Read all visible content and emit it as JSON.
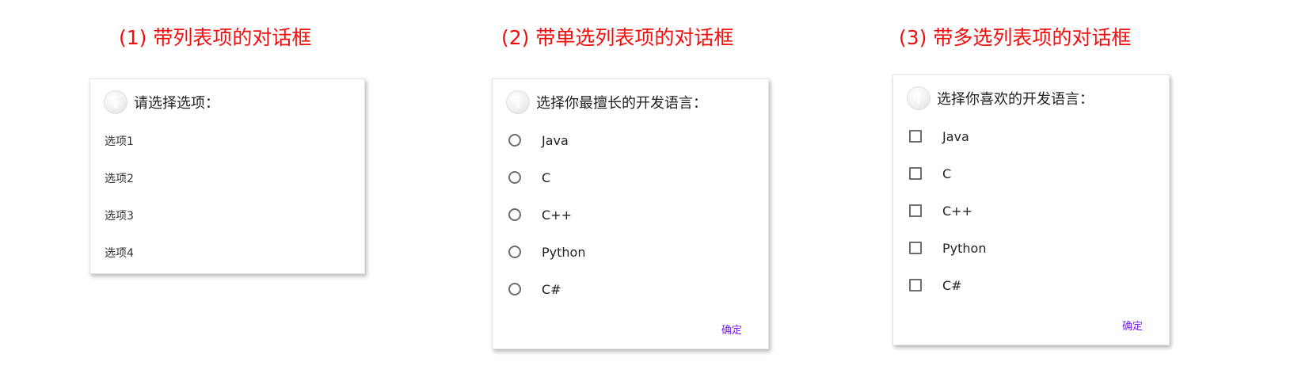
{
  "captions": {
    "c1": "(1) 带列表项的对话框",
    "c2": "(2) 带单选列表项的对话框",
    "c3": "(3) 带多选列表项的对话框"
  },
  "dialog1": {
    "icon": "info-icon",
    "title": "请选择选项：",
    "items": [
      "选项1",
      "选项2",
      "选项3",
      "选项4"
    ]
  },
  "dialog2": {
    "icon": "info-icon",
    "title": "选择你最擅长的开发语言：",
    "options": [
      "Java",
      "C",
      "C++",
      "Python",
      "C#"
    ],
    "ok": "确定"
  },
  "dialog3": {
    "icon": "info-icon",
    "title": "选择你喜欢的开发语言：",
    "options": [
      "Java",
      "C",
      "C++",
      "Python",
      "C#"
    ],
    "ok": "确定"
  },
  "colors": {
    "caption": "#f20d0d",
    "accent": "#7a1cf0"
  }
}
